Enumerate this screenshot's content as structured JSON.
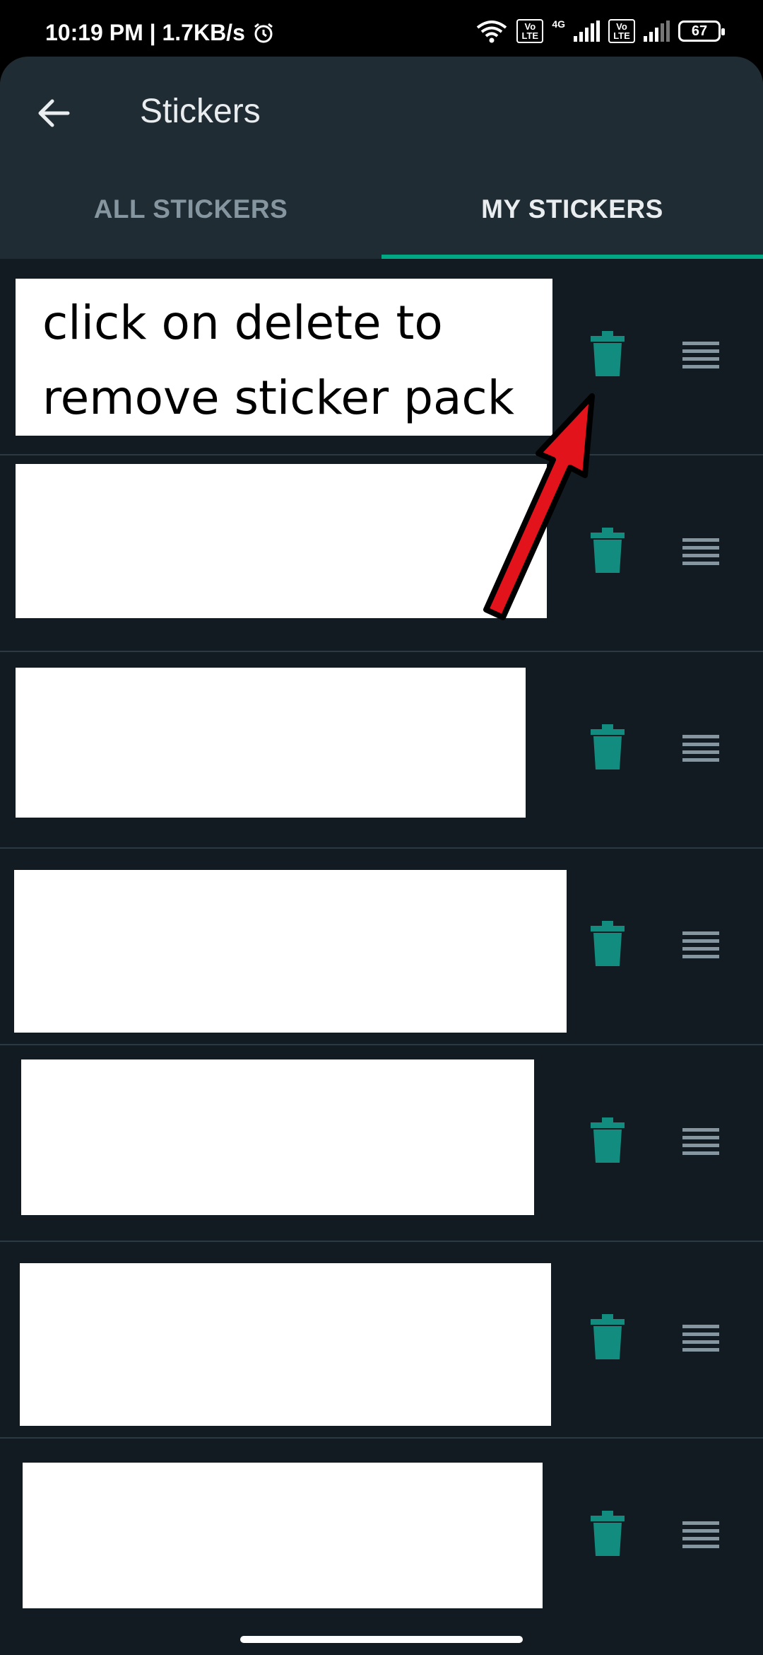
{
  "status_bar": {
    "time_speed": "10:19 PM | 1.7KB/s",
    "volte1": "Vo",
    "lte1": "LTE",
    "net_type": "4G",
    "volte2": "Vo",
    "lte2": "LTE",
    "battery": "67"
  },
  "header": {
    "title": "Stickers",
    "tabs": [
      {
        "label": "ALL STICKERS",
        "selected": false
      },
      {
        "label": "MY STICKERS",
        "selected": true
      }
    ],
    "accent_color": "#00a884"
  },
  "annotation": {
    "line1": "click on delete to",
    "line2": "remove sticker pack",
    "arrow_color": "#e3131b"
  },
  "sticker_packs": [
    {
      "delete_icon": "trash-icon",
      "drag_icon": "drag-handle-icon"
    },
    {
      "delete_icon": "trash-icon",
      "drag_icon": "drag-handle-icon"
    },
    {
      "delete_icon": "trash-icon",
      "drag_icon": "drag-handle-icon"
    },
    {
      "delete_icon": "trash-icon",
      "drag_icon": "drag-handle-icon"
    },
    {
      "delete_icon": "trash-icon",
      "drag_icon": "drag-handle-icon"
    },
    {
      "delete_icon": "trash-icon",
      "drag_icon": "drag-handle-icon"
    },
    {
      "delete_icon": "trash-icon",
      "drag_icon": "drag-handle-icon"
    }
  ]
}
